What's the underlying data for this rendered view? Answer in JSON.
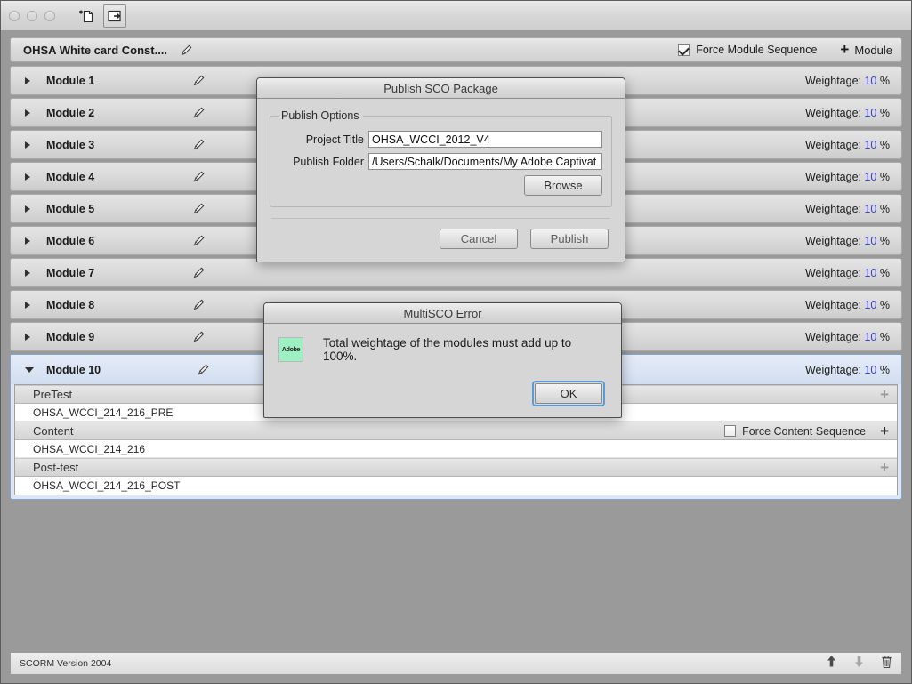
{
  "window": {
    "toolbar": {
      "new_icon": "new-document-icon",
      "export_icon": "export-icon"
    }
  },
  "project_bar": {
    "title": "OHSA White card Const....",
    "edit_icon": "pencil-icon",
    "force_module_sequence": {
      "label": "Force Module Sequence",
      "checked": true
    },
    "add_module": {
      "plus": "+",
      "label": "Module"
    }
  },
  "modules": [
    {
      "name": "Module 1",
      "expanded": false,
      "selected": false,
      "weightage_label": "Weightage:",
      "weightage_value": "10",
      "weightage_unit": "%"
    },
    {
      "name": "Module 2",
      "expanded": false,
      "selected": false,
      "weightage_label": "Weightage:",
      "weightage_value": "10",
      "weightage_unit": "%"
    },
    {
      "name": "Module 3",
      "expanded": false,
      "selected": false,
      "weightage_label": "Weightage:",
      "weightage_value": "10",
      "weightage_unit": "%"
    },
    {
      "name": "Module 4",
      "expanded": false,
      "selected": false,
      "weightage_label": "Weightage:",
      "weightage_value": "10",
      "weightage_unit": "%"
    },
    {
      "name": "Module 5",
      "expanded": false,
      "selected": false,
      "weightage_label": "Weightage:",
      "weightage_value": "10",
      "weightage_unit": "%"
    },
    {
      "name": "Module 6",
      "expanded": false,
      "selected": false,
      "weightage_label": "Weightage:",
      "weightage_value": "10",
      "weightage_unit": "%"
    },
    {
      "name": "Module 7",
      "expanded": false,
      "selected": false,
      "weightage_label": "Weightage:",
      "weightage_value": "10",
      "weightage_unit": "%"
    },
    {
      "name": "Module 8",
      "expanded": false,
      "selected": false,
      "weightage_label": "Weightage:",
      "weightage_value": "10",
      "weightage_unit": "%"
    },
    {
      "name": "Module 9",
      "expanded": false,
      "selected": false,
      "weightage_label": "Weightage:",
      "weightage_value": "10",
      "weightage_unit": "%"
    },
    {
      "name": "Module 10",
      "expanded": true,
      "selected": true,
      "weightage_label": "Weightage:",
      "weightage_value": "10",
      "weightage_unit": "%"
    }
  ],
  "module10_sections": [
    {
      "header": "PreTest",
      "plus": "+",
      "plus_enabled": false,
      "has_force_content_checkbox": false,
      "force_content_label": "",
      "force_content_checked": false,
      "items": [
        "OHSA_WCCI_214_216_PRE"
      ]
    },
    {
      "header": "Content",
      "plus": "+",
      "plus_enabled": true,
      "has_force_content_checkbox": true,
      "force_content_label": "Force Content Sequence",
      "force_content_checked": false,
      "items": [
        "OHSA_WCCI_214_216"
      ]
    },
    {
      "header": "Post-test",
      "plus": "+",
      "plus_enabled": false,
      "has_force_content_checkbox": false,
      "force_content_label": "",
      "force_content_checked": false,
      "items": [
        "OHSA_WCCI_214_216_POST"
      ]
    }
  ],
  "statusbar": {
    "text": "SCORM Version 2004",
    "move_up_icon": "arrow-up-icon",
    "move_down_icon": "arrow-down-icon",
    "delete_icon": "trash-icon"
  },
  "publish_dialog": {
    "title": "Publish SCO Package",
    "group_label": "Publish Options",
    "project_title_label": "Project Title",
    "project_title_value": "OHSA_WCCI_2012_V4",
    "publish_folder_label": "Publish Folder",
    "publish_folder_value": "/Users/Schalk/Documents/My Adobe Captivat",
    "browse_label": "Browse",
    "cancel_label": "Cancel",
    "publish_label": "Publish"
  },
  "error_dialog": {
    "title": "MultiSCO Error",
    "icon_label": "Adobe",
    "message": "Total weightage of the modules must add up to 100%.",
    "ok_label": "OK"
  },
  "colors": {
    "weightage_value": "#4040d0",
    "selection": "#dde6f3",
    "focus_ring": "#5b9bd9",
    "adobe_icon_bg": "#9ef0c2"
  }
}
